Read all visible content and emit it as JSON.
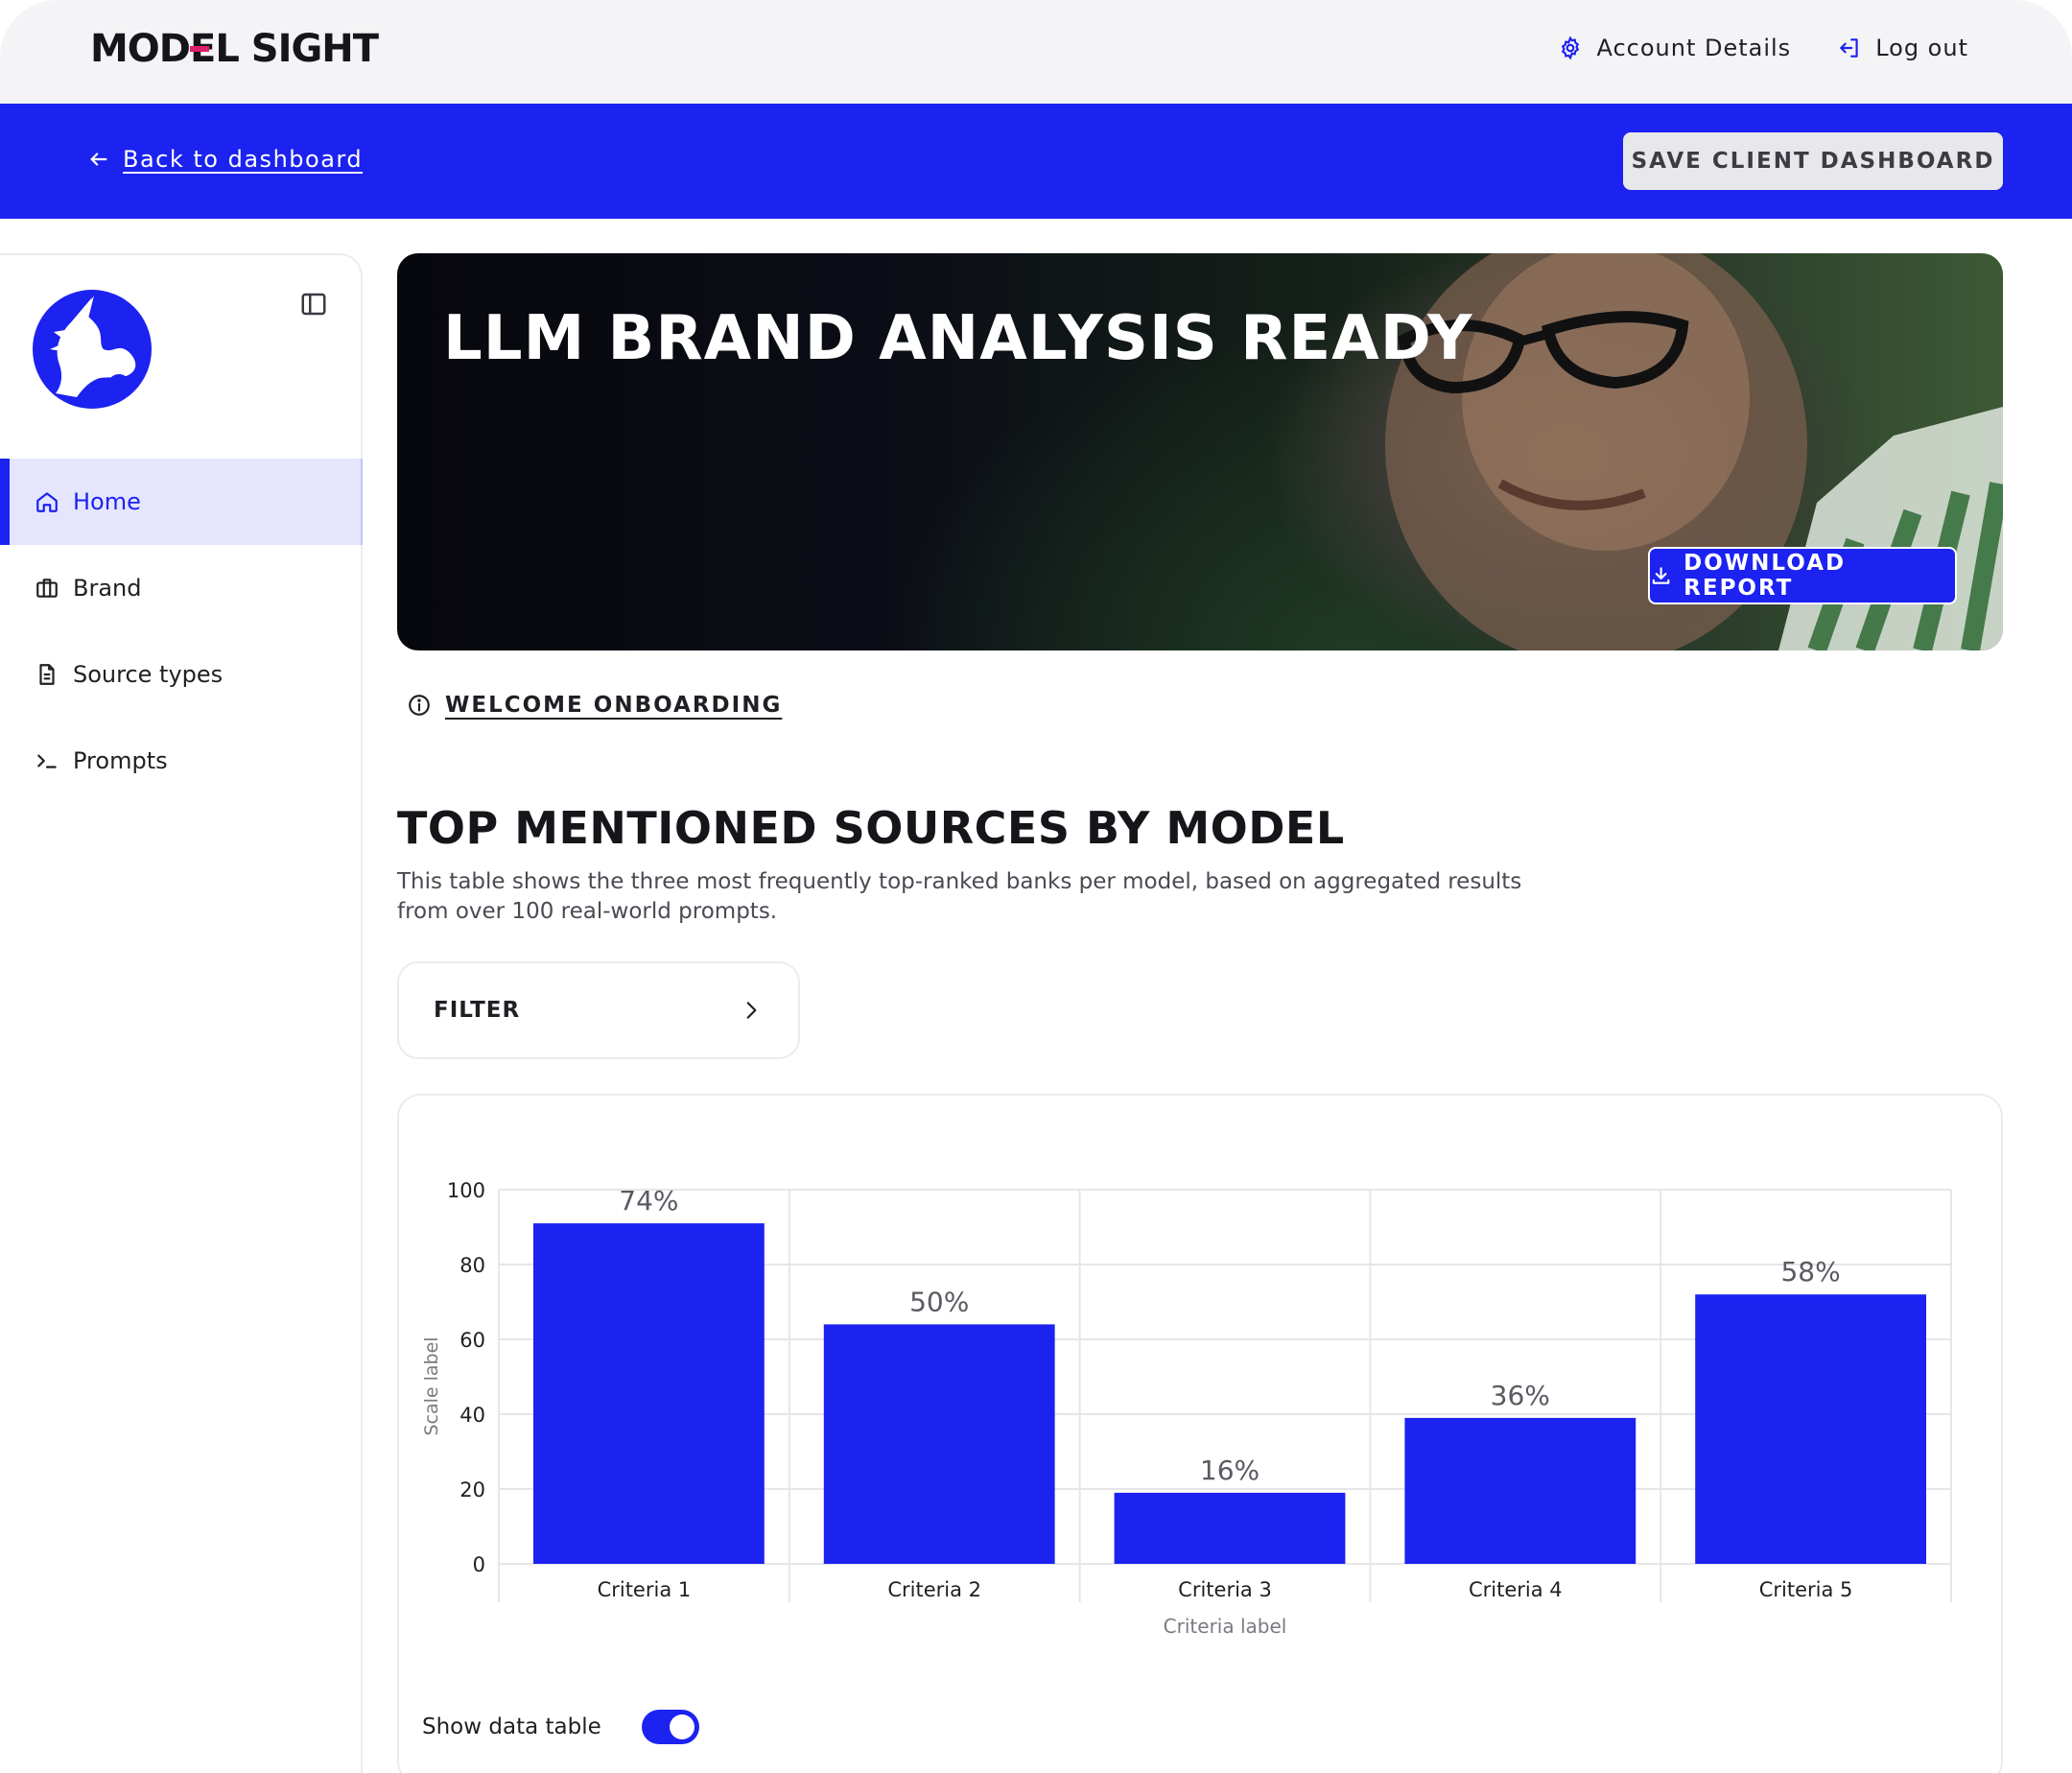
{
  "header": {
    "logo": "MODEL SIGHT",
    "account_label": "Account Details",
    "logout_label": "Log out"
  },
  "band": {
    "back_label": "Back to dashboard",
    "save_label": "SAVE CLIENT DASHBOARD"
  },
  "sidebar": {
    "items": [
      {
        "label": "Home",
        "icon": "home-icon",
        "active": true
      },
      {
        "label": "Brand",
        "icon": "briefcase-icon",
        "active": false
      },
      {
        "label": "Source types",
        "icon": "document-icon",
        "active": false
      },
      {
        "label": "Prompts",
        "icon": "terminal-icon",
        "active": false
      }
    ]
  },
  "hero": {
    "title": "LLM BRAND ANALYSIS READY",
    "download_label": "DOWNLOAD REPORT"
  },
  "welcome_label": "WELCOME ONBOARDING",
  "section": {
    "title": "TOP MENTIONED SOURCES BY MODEL",
    "description": "This table shows the three most frequently top-ranked banks per model, based on aggregated results from over 100 real-world prompts."
  },
  "filter_label": "FILTER",
  "toggle_label": "Show data table",
  "colors": {
    "accent": "#1c22f0",
    "active_bg": "#e5e6fd"
  },
  "chart_data": {
    "type": "bar",
    "categories": [
      "Criteria 1",
      "Criteria 2",
      "Criteria 3",
      "Criteria 4",
      "Criteria 5"
    ],
    "values": [
      91,
      64,
      19,
      39,
      72
    ],
    "data_labels": [
      "74%",
      "50%",
      "16%",
      "36%",
      "58%"
    ],
    "xlabel": "Criteria label",
    "ylabel": "Scale label",
    "ylim": [
      0,
      100
    ],
    "yticks": [
      0,
      20,
      40,
      60,
      80,
      100
    ],
    "grid": true
  }
}
